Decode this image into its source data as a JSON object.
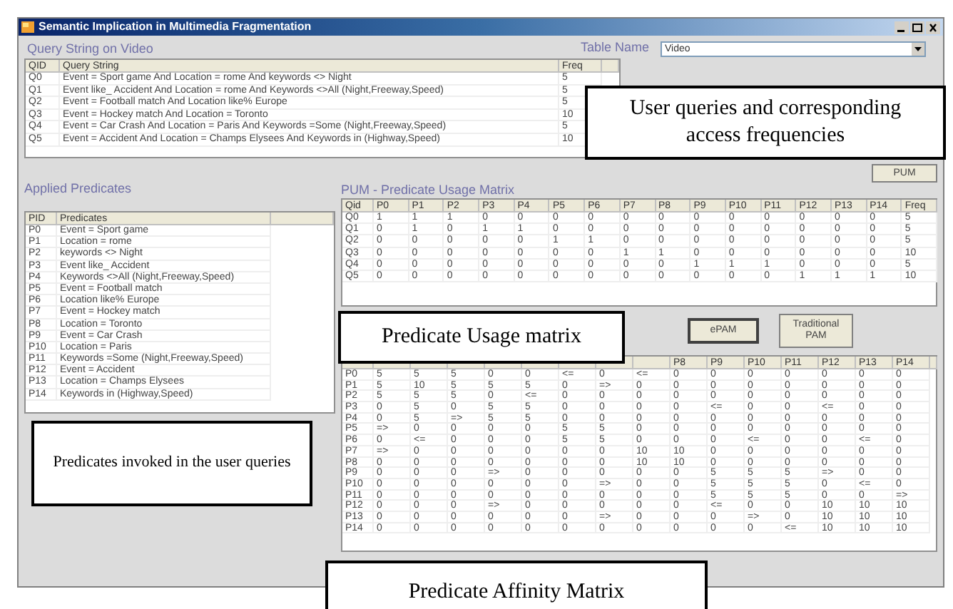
{
  "window": {
    "title": "Semantic Implication in Multimedia Fragmentation"
  },
  "query_section": {
    "title": "Query String on Video",
    "columns": [
      "QID",
      "Query String",
      "Freq"
    ],
    "rows": [
      [
        "Q0",
        "Event = Sport game And Location = rome And keywords <> Night",
        "5"
      ],
      [
        "Q1",
        "Event like_ Accident And Location = rome And  Keywords <>All (Night,Freeway,Speed)",
        "5"
      ],
      [
        "Q2",
        "Event = Football match And Location like% Europe",
        "5"
      ],
      [
        "Q3",
        "Event = Hockey match And Location = Toronto",
        "10"
      ],
      [
        "Q4",
        "Event = Car Crash And Location = Paris And  Keywords =Some (Night,Freeway,Speed)",
        "5"
      ],
      [
        "Q5",
        "Event = Accident And Location = Champs Elysees And Keywords in (Highway,Speed)",
        "10"
      ]
    ]
  },
  "table_name": {
    "label": "Table Name",
    "value": "Video"
  },
  "predicates": {
    "title": "Applied Predicates",
    "columns": [
      "PID",
      "Predicates"
    ],
    "rows": [
      [
        "P0",
        "Event = Sport game"
      ],
      [
        "P1",
        "Location = rome"
      ],
      [
        "P2",
        "keywords <> Night"
      ],
      [
        "P3",
        "Event like_ Accident"
      ],
      [
        "P4",
        "Keywords <>All (Night,Freeway,Speed)"
      ],
      [
        "P5",
        "Event = Football match"
      ],
      [
        "P6",
        "Location like% Europe"
      ],
      [
        "P7",
        "Event = Hockey match"
      ],
      [
        "P8",
        "Location = Toronto"
      ],
      [
        "P9",
        "Event = Car Crash"
      ],
      [
        "P10",
        "Location = Paris"
      ],
      [
        "P11",
        "Keywords =Some (Night,Freeway,Speed)"
      ],
      [
        "P12",
        "Event = Accident"
      ],
      [
        "P13",
        "Location = Champs Elysees"
      ],
      [
        "P14",
        "Keywords in (Highway,Speed)"
      ]
    ]
  },
  "pum": {
    "title": "PUM - Predicate Usage Matrix",
    "button": "PUM",
    "columns": [
      "Qid",
      "P0",
      "P1",
      "P2",
      "P3",
      "P4",
      "P5",
      "P6",
      "P7",
      "P8",
      "P9",
      "P10",
      "P11",
      "P12",
      "P13",
      "P14",
      "Freq"
    ],
    "rows": [
      [
        "Q0",
        "1",
        "1",
        "1",
        "0",
        "0",
        "0",
        "0",
        "0",
        "0",
        "0",
        "0",
        "0",
        "0",
        "0",
        "0",
        "5"
      ],
      [
        "Q1",
        "0",
        "1",
        "0",
        "1",
        "1",
        "0",
        "0",
        "0",
        "0",
        "0",
        "0",
        "0",
        "0",
        "0",
        "0",
        "5"
      ],
      [
        "Q2",
        "0",
        "0",
        "0",
        "0",
        "0",
        "1",
        "1",
        "0",
        "0",
        "0",
        "0",
        "0",
        "0",
        "0",
        "0",
        "5"
      ],
      [
        "Q3",
        "0",
        "0",
        "0",
        "0",
        "0",
        "0",
        "0",
        "1",
        "1",
        "0",
        "0",
        "0",
        "0",
        "0",
        "0",
        "10"
      ],
      [
        "Q4",
        "0",
        "0",
        "0",
        "0",
        "0",
        "0",
        "0",
        "0",
        "0",
        "1",
        "1",
        "1",
        "0",
        "0",
        "0",
        "5"
      ],
      [
        "Q5",
        "0",
        "0",
        "0",
        "0",
        "0",
        "0",
        "0",
        "0",
        "0",
        "0",
        "0",
        "0",
        "1",
        "1",
        "1",
        "10"
      ]
    ]
  },
  "pam": {
    "buttons": [
      "ePAM",
      "Traditional PAM"
    ],
    "visible_columns": [
      "P8",
      "P9",
      "P10",
      "P11",
      "P12",
      "P13",
      "P14"
    ],
    "rows": [
      [
        "P0",
        "5",
        "5",
        "5",
        "0",
        "0",
        {
          "kind": "arrow",
          "text": "<="
        },
        "0",
        {
          "kind": "arrow",
          "text": "<="
        },
        "0",
        "0",
        "0",
        "0",
        "0",
        "0",
        "0"
      ],
      [
        "P1",
        "5",
        "10",
        "5",
        "5",
        "5",
        "0",
        {
          "kind": "arrow",
          "text": "=>"
        },
        "0",
        "0",
        "0",
        "0",
        "0",
        "0",
        "0",
        "0"
      ],
      [
        "P2",
        "5",
        "5",
        "5",
        "0",
        {
          "kind": "arrow",
          "text": "<="
        },
        "0",
        "0",
        "0",
        "0",
        "0",
        "0",
        "0",
        "0",
        "0",
        "0"
      ],
      [
        "P3",
        "0",
        "5",
        "0",
        "5",
        "5",
        "0",
        "0",
        "0",
        "0",
        {
          "kind": "arrow",
          "text": "<="
        },
        "0",
        "0",
        {
          "kind": "arrow",
          "text": "<="
        },
        "0",
        "0"
      ],
      [
        "P4",
        "0",
        "5",
        {
          "kind": "arrow",
          "text": "=>"
        },
        "5",
        "5",
        "0",
        "0",
        "0",
        "0",
        "0",
        "0",
        "0",
        "0",
        "0",
        "0"
      ],
      [
        "P5",
        {
          "kind": "arrow",
          "text": "=>"
        },
        "0",
        "0",
        "0",
        "0",
        "5",
        "5",
        "0",
        "0",
        "0",
        "0",
        "0",
        "0",
        "0",
        "0"
      ],
      [
        "P6",
        "0",
        {
          "kind": "arrow",
          "text": "<="
        },
        "0",
        "0",
        "0",
        "5",
        "5",
        "0",
        "0",
        "0",
        {
          "kind": "arrow",
          "text": "<="
        },
        "0",
        "0",
        {
          "kind": "arrow",
          "text": "<="
        },
        "0"
      ],
      [
        "P7",
        {
          "kind": "arrow",
          "text": "=>"
        },
        "0",
        "0",
        "0",
        "0",
        "0",
        "0",
        "10",
        "10",
        "0",
        "0",
        "0",
        "0",
        "0",
        "0"
      ],
      [
        "P8",
        "0",
        "0",
        "0",
        "0",
        "0",
        "0",
        "0",
        "10",
        "10",
        "0",
        "0",
        "0",
        "0",
        "0",
        "0"
      ],
      [
        "P9",
        "0",
        "0",
        "0",
        {
          "kind": "arrow",
          "text": "=>"
        },
        "0",
        "0",
        "0",
        "0",
        "0",
        "5",
        "5",
        "5",
        {
          "kind": "arrow",
          "text": "=>"
        },
        "0",
        "0"
      ],
      [
        "P10",
        "0",
        "0",
        "0",
        "0",
        "0",
        "0",
        {
          "kind": "arrow",
          "text": "=>"
        },
        "0",
        "0",
        "5",
        "5",
        "5",
        "0",
        {
          "kind": "arrow",
          "text": "<="
        },
        "0"
      ],
      [
        "P11",
        "0",
        "0",
        "0",
        "0",
        "0",
        "0",
        "0",
        "0",
        "0",
        "5",
        "5",
        "5",
        "0",
        "0",
        {
          "kind": "arrow",
          "text": "=>"
        }
      ],
      [
        "P12",
        "0",
        "0",
        "0",
        {
          "kind": "arrow",
          "text": "=>"
        },
        "0",
        "0",
        "0",
        "0",
        "0",
        {
          "kind": "arrow",
          "text": "<="
        },
        "0",
        "0",
        "10",
        "10",
        "10"
      ],
      [
        "P13",
        "0",
        "0",
        "0",
        "0",
        "0",
        "0",
        {
          "kind": "arrow",
          "text": "=>"
        },
        "0",
        "0",
        "0",
        {
          "kind": "arrow",
          "text": "=>"
        },
        "0",
        "10",
        "10",
        "10"
      ],
      [
        "P14",
        "0",
        "0",
        "0",
        "0",
        "0",
        "0",
        "0",
        "0",
        "0",
        "0",
        "0",
        {
          "kind": "arrow",
          "text": "<="
        },
        "10",
        "10",
        "10"
      ]
    ]
  },
  "callouts": [
    "User queries and corresponding access frequencies",
    "Predicates invoked in the user queries",
    "Predicate Usage matrix",
    "Predicate Affinity Matrix"
  ]
}
